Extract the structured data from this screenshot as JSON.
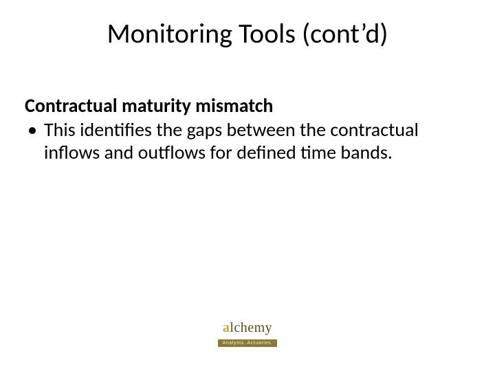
{
  "title": "Monitoring Tools (cont’d)",
  "subheading": "Contractual maturity mismatch",
  "bullets": [
    "This identifies the gaps between the contractual inflows and outflows for defined time bands."
  ],
  "logo": {
    "word_part1": "a",
    "word_part2": "lchemy",
    "tagline": "Analysts. Actuaries."
  }
}
